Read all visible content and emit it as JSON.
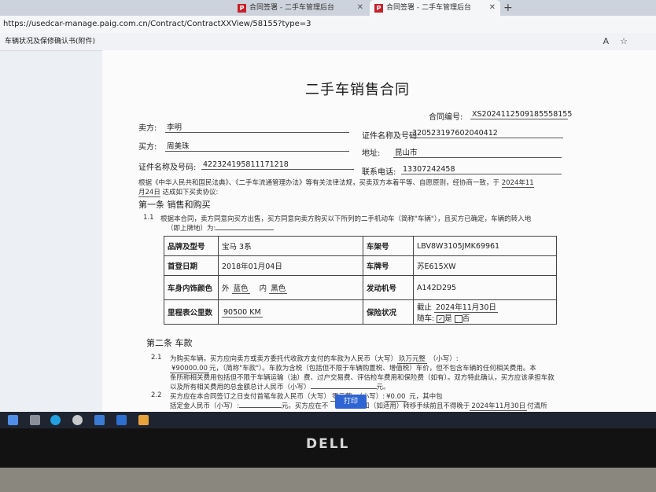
{
  "browser": {
    "tabs": [
      {
        "label": "合同签署 - 二手车管理后台",
        "active": false
      },
      {
        "label": "合同签署 - 二手车管理后台",
        "active": true
      }
    ],
    "url": "https://usedcar-manage.paig.com.cn/Contract/ContractXXView/58155?type=3",
    "page_title": "车辆状况及保修确认书(附件)"
  },
  "contract": {
    "title": "二手车销售合同",
    "contract_no_label": "合同编号:",
    "contract_no": "XS20241125091855581​55",
    "seller_label": "卖方:",
    "seller": "李明",
    "id_label": "证件名称及号码:",
    "seller_id": "320523197602040412",
    "buyer_label": "买方:",
    "buyer": "周美珠",
    "address_label": "地址:",
    "address": "昆山市",
    "buyer_id_label": "证件名称及号码:",
    "buyer_id": "422324195811171218",
    "phone_label": "联系电话:",
    "phone": "13307242458",
    "preamble_1": "根据《中华人民共和国民法典》、《二手车流通管理办法》等有关法律法规，买卖双方本着平等、自愿原则，经协商一致，于",
    "preamble_date_1": "2024年11",
    "preamble_2": "月24日",
    "preamble_3": "达成如下买卖协议:",
    "section1": "第一条 销售和购买",
    "clause_1_1_no": "1.1",
    "clause_1_1_a": "根据本合同，卖方同意向买方出售，买方同意向卖方购买以下所列的二手机动车（简称\"车辆\"），且买方已确定，车辆的转入地",
    "clause_1_1_b": "（即上牌地）为:",
    "section2": "第二条 车款",
    "clause_2_1_no": "2.1",
    "clause_2_1_a": "为购买车辆，买方应向卖方或卖方委托代收款方支付的车款为人民币（大写）",
    "price_upper": "玖万元整",
    "lowercase_label": "（小写）:",
    "clause_2_1_price": "¥90000.00",
    "clause_2_1_b": "元，（简称\"车款\"）。车款为含税（包括但不限于车辆购置税、增值税）车价，但不包含车辆的任何相关费用。本",
    "clause_2_1_c": "条所称相关费用包括但不限于车辆运输（油）费、过户交易费、评估检车费用和保险费（如有）。双方特此确认，买方应该承担车款",
    "clause_2_1_d": "以及所有相关费用的总金额总计人民币（小写）",
    "yuan": "元。",
    "clause_2_2_no": "2.2",
    "clause_2_2_a": "买方应在本合同签订之日支付首笔车款人民币（大写）",
    "clause_2_2_upper": "零元整",
    "clause_2_2_lower_label": "（小写）:",
    "clause_2_2_lower": "¥0.00",
    "clause_2_2_b": "元，其中包",
    "clause_2_2_c": "括定金人民币（小写）:",
    "clause_2_2_d": "元。买方应在不",
    "clause_2_2_e": "和（如适用）转移手续前且不得晚于",
    "clause_2_2_date": "2024年11月30日",
    "clause_2_2_f": "付清所"
  },
  "vehicle": {
    "brand_label": "品牌及型号",
    "brand": "宝马 3系",
    "vin_label": "车架号",
    "vin": "LBV8W3105JMK69961",
    "reg_label": "首登日期",
    "reg_date": "2018年01月04日",
    "plate_label": "车牌号",
    "plate": "苏E615XW",
    "color_label": "车身内饰颜色",
    "exterior_prefix": "外",
    "exterior": "蓝色",
    "interior_prefix": "内",
    "interior": "黑色",
    "engine_label": "发动机号",
    "engine": "A142D295",
    "mileage_label": "里程表公里数",
    "mileage": "90500 KM",
    "insurance_label": "保险状况",
    "insurance_until_prefix": "截止",
    "insurance_until": "2024年11月30日",
    "with_car_label": "随车:",
    "yes_label": "是",
    "no_label": "否",
    "yes_checked": true
  },
  "actions": {
    "print_label": "打印"
  },
  "monitor": {
    "brand": "DELL"
  }
}
